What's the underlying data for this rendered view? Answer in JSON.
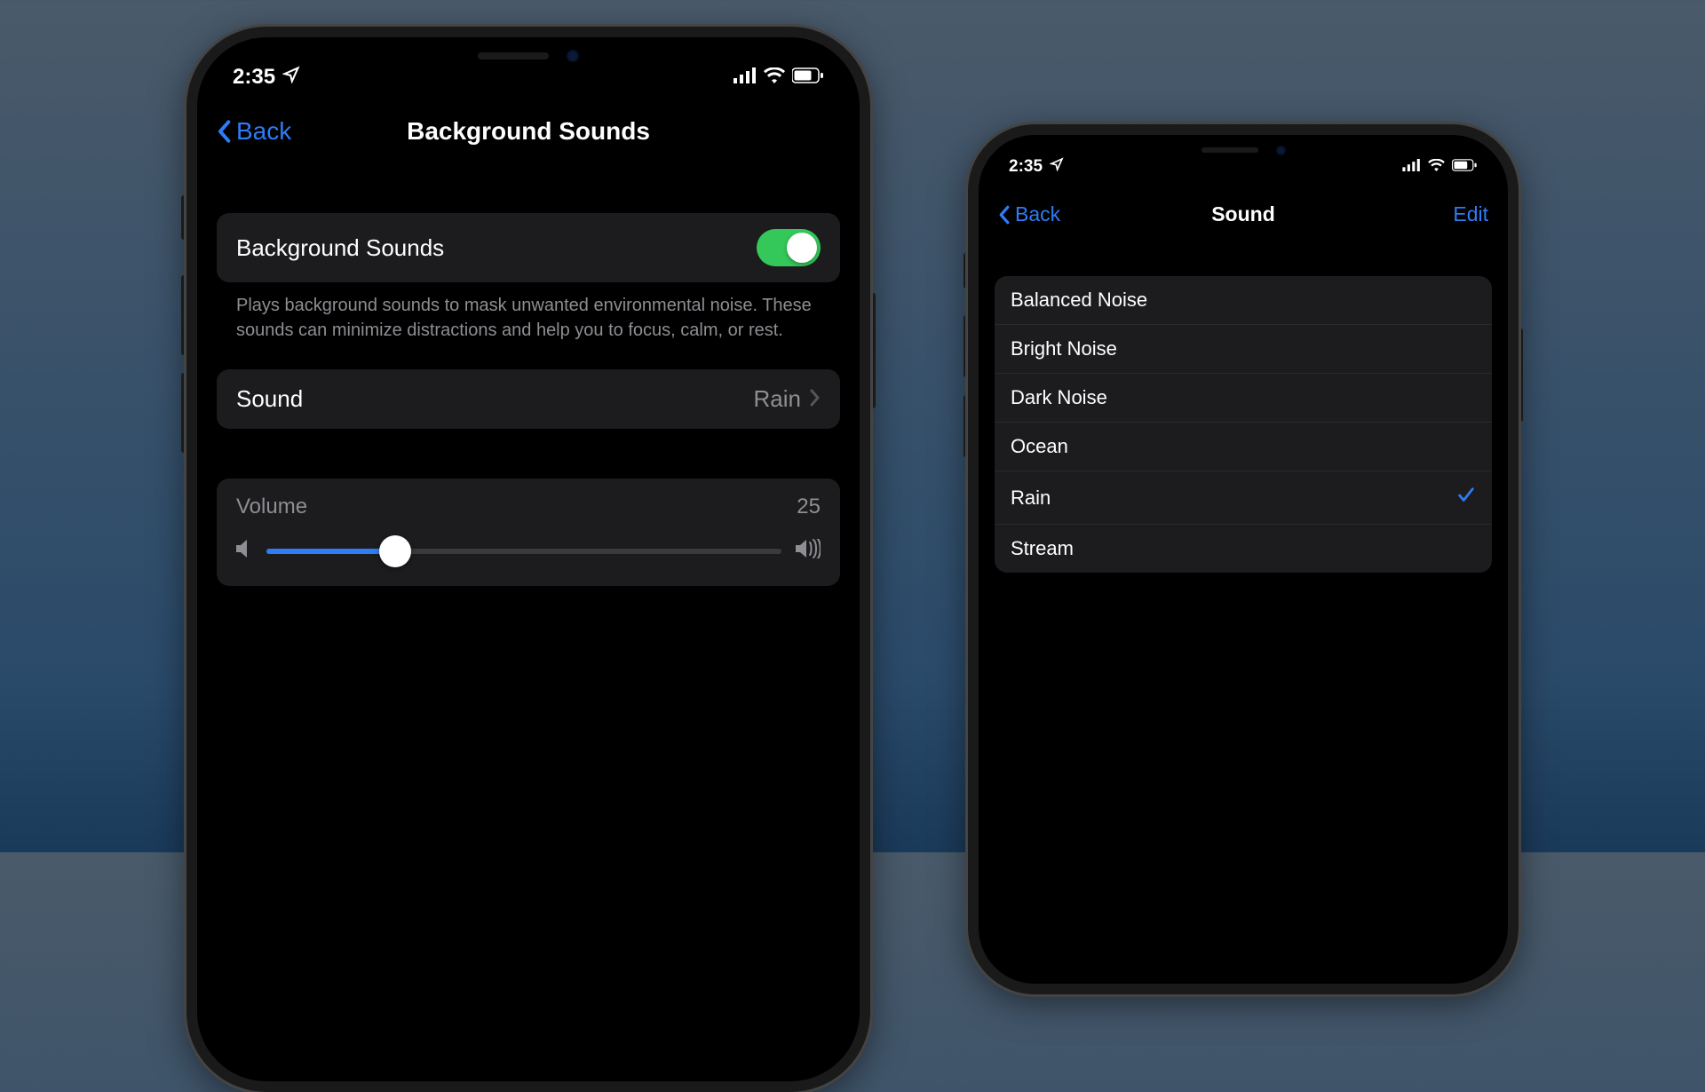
{
  "status": {
    "time": "2:35"
  },
  "phone1": {
    "nav": {
      "back": "Back",
      "title": "Background Sounds"
    },
    "main_toggle": {
      "label": "Background Sounds",
      "on": true
    },
    "description": "Plays background sounds to mask unwanted environmental noise. These sounds can minimize distractions and help you to focus, calm, or rest.",
    "sound_row": {
      "label": "Sound",
      "value": "Rain"
    },
    "volume": {
      "label": "Volume",
      "value": "25",
      "percent": 25
    }
  },
  "phone2": {
    "nav": {
      "back": "Back",
      "title": "Sound",
      "edit": "Edit"
    },
    "options": [
      {
        "label": "Balanced Noise",
        "selected": false
      },
      {
        "label": "Bright Noise",
        "selected": false
      },
      {
        "label": "Dark Noise",
        "selected": false
      },
      {
        "label": "Ocean",
        "selected": false
      },
      {
        "label": "Rain",
        "selected": true
      },
      {
        "label": "Stream",
        "selected": false
      }
    ]
  }
}
